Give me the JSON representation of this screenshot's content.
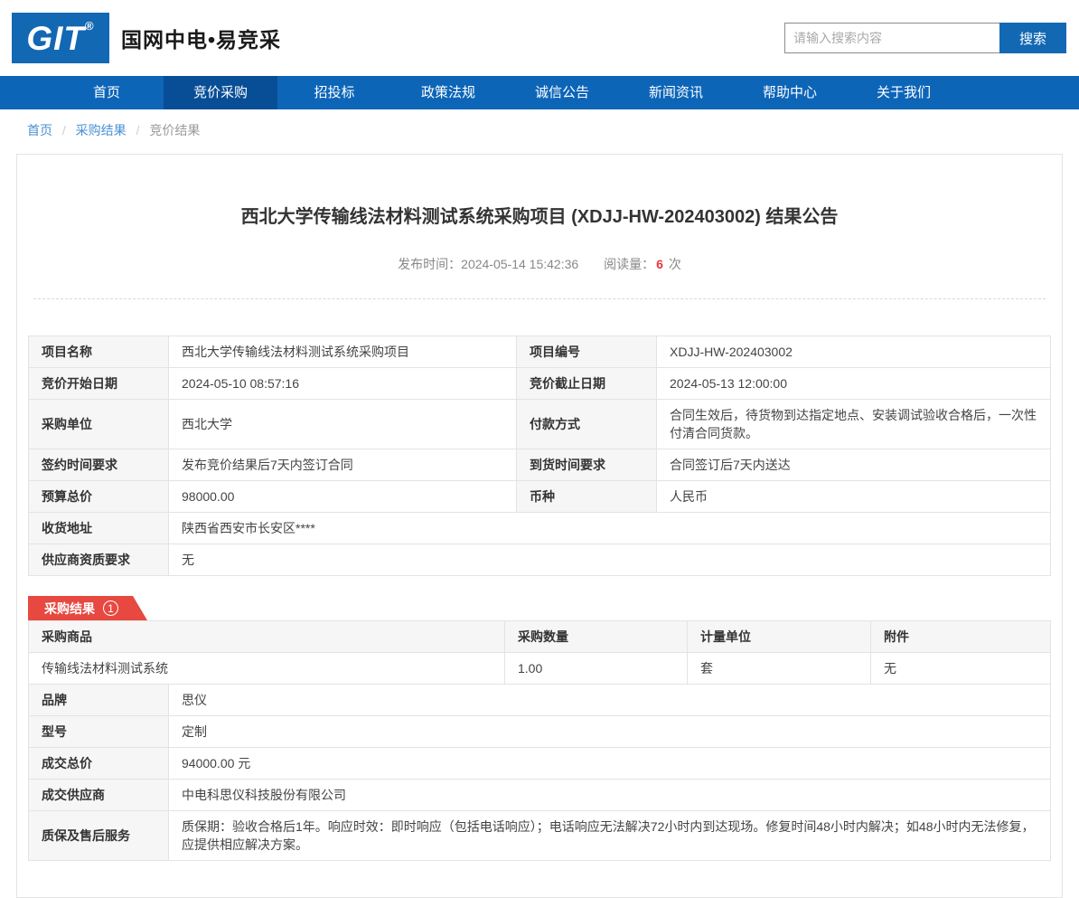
{
  "colors": {
    "primary_blue": "#0d65b8",
    "nav_active_blue": "#084e96",
    "logo_blue": "#1268b3",
    "link_blue": "#4a90d2",
    "price_red": "#e4393c",
    "badge_red": "#e74840",
    "label_cell_bg": "#f6f6f6"
  },
  "header": {
    "logo_text": "GIT",
    "logo_reg": "®",
    "brand": "国网中电•易竞采",
    "search": {
      "placeholder": "请输入搜索内容",
      "button": "搜索"
    }
  },
  "nav": {
    "items": [
      "首页",
      "竞价采购",
      "招投标",
      "政策法规",
      "诚信公告",
      "新闻资讯",
      "帮助中心",
      "关于我们"
    ],
    "active_index": 1
  },
  "breadcrumb": {
    "items": [
      "首页",
      "采购结果",
      "竞价结果"
    ],
    "separator": "/"
  },
  "announcement": {
    "title": "西北大学传输线法材料测试系统采购项目 (XDJJ-HW-202403002) 结果公告",
    "publish_label": "发布时间：",
    "publish_time": "2024-05-14 15:42:36",
    "views_label": "阅读量：",
    "views_count": "6",
    "views_unit": "次"
  },
  "project_info": {
    "rows": [
      {
        "label1": "项目名称",
        "value1": "西北大学传输线法材料测试系统采购项目",
        "label2": "项目编号",
        "value2": "XDJJ-HW-202403002"
      },
      {
        "label1": "竞价开始日期",
        "value1": "2024-05-10 08:57:16",
        "label2": "竞价截止日期",
        "value2": "2024-05-13 12:00:00"
      },
      {
        "label1": "采购单位",
        "value1": "西北大学",
        "label2": "付款方式",
        "value2": "合同生效后，待货物到达指定地点、安装调试验收合格后，一次性付清合同货款。"
      },
      {
        "label1": "签约时间要求",
        "value1": "发布竞价结果后7天内签订合同",
        "label2": "到货时间要求",
        "value2": "合同签订后7天内送达"
      },
      {
        "label1": "预算总价",
        "value1": "98000.00",
        "label2": "币种",
        "value2": "人民币"
      }
    ],
    "full_rows": [
      {
        "label": "收货地址",
        "value": "陕西省西安市长安区****"
      },
      {
        "label": "供应商资质要求",
        "value": "无"
      }
    ]
  },
  "result_section": {
    "badge_label": "采购结果",
    "badge_number": "1",
    "product_table": {
      "headers": [
        "采购商品",
        "采购数量",
        "计量单位",
        "附件"
      ],
      "row": [
        "传输线法材料测试系统",
        "1.00",
        "套",
        "无"
      ]
    },
    "detail_rows": [
      {
        "label": "品牌",
        "value": "思仪"
      },
      {
        "label": "型号",
        "value": "定制"
      },
      {
        "label": "成交总价",
        "value": "94000.00 元"
      },
      {
        "label": "成交供应商",
        "value": "中电科思仪科技股份有限公司"
      },
      {
        "label": "质保及售后服务",
        "value": "质保期：验收合格后1年。响应时效：即时响应（包括电话响应）；电话响应无法解决72小时内到达现场。修复时间48小时内解决；如48小时内无法修复，应提供相应解决方案。"
      }
    ]
  }
}
